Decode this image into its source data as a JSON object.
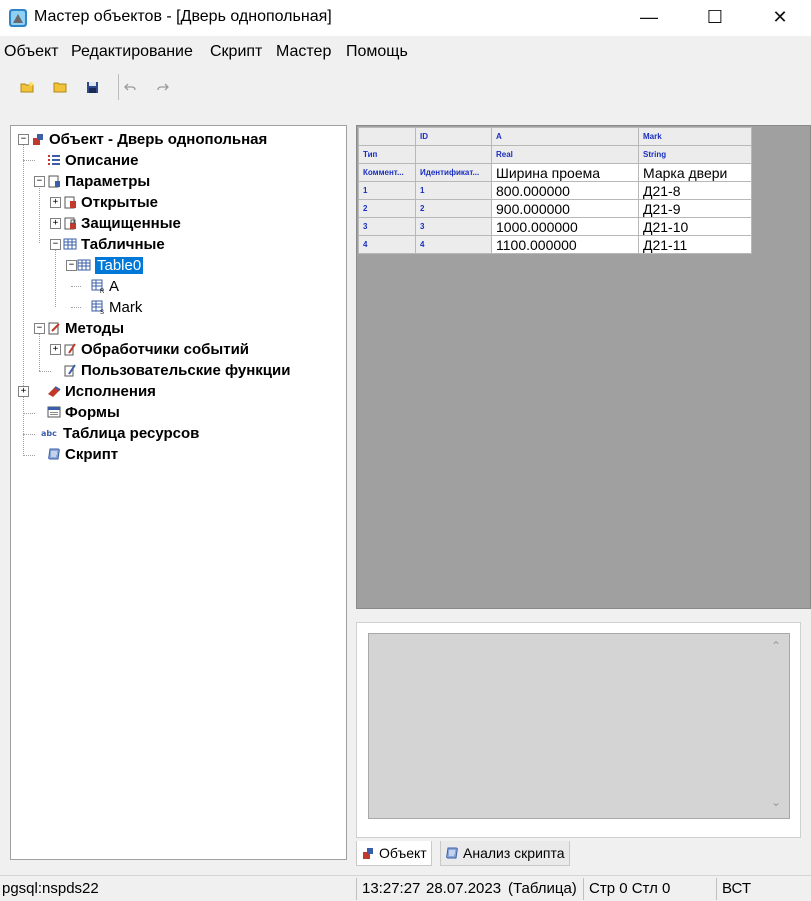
{
  "window": {
    "title": "Мастер объектов - [Дверь однопольная]",
    "controls": {
      "minimize": "—",
      "maximize": "☐",
      "close": "✕"
    }
  },
  "menu": [
    "Объект",
    "Редактирование",
    "Скрипт",
    "Мастер",
    "Помощь"
  ],
  "toolbar": {
    "buttons": [
      "new-icon",
      "open-folder-icon",
      "save-icon",
      "undo-icon",
      "redo-icon"
    ]
  },
  "tree": {
    "root": "Объект - Дверь однопольная",
    "description": "Описание",
    "parameters": "Параметры",
    "open": "Открытые",
    "protected": "Защищенные",
    "tabular": "Табличные",
    "table0": "Table0",
    "col_a": "A",
    "col_mark": "Mark",
    "methods": "Методы",
    "event_handlers": "Обработчики событий",
    "user_functions": "Пользовательские функции",
    "executions": "Исполнения",
    "forms": "Формы",
    "resources": "Таблица ресурсов",
    "script": "Скрипт"
  },
  "grid": {
    "header_top": [
      "",
      "ID",
      "A",
      "Mark"
    ],
    "header_type": [
      "Тип",
      "",
      "Real",
      "String"
    ],
    "header_comment": [
      "Коммент...",
      "Идентификат...",
      "Ширина проема",
      "Марка двери"
    ],
    "rows": [
      [
        "1",
        "1",
        "800.000000",
        "Д21-8"
      ],
      [
        "2",
        "2",
        "900.000000",
        "Д21-9"
      ],
      [
        "3",
        "3",
        "1000.000000",
        "Д21-10"
      ],
      [
        "4",
        "4",
        "1100.000000",
        "Д21-11"
      ]
    ]
  },
  "tabs": {
    "object": "Объект",
    "analysis": "Анализ скрипта"
  },
  "status": {
    "connection": "pgsql:nspds22",
    "time": "13:27:27",
    "date": "28.07.2023",
    "mode": "(Таблица)",
    "position": "Стр 0 Стл 0",
    "insert": "ВСТ"
  },
  "colors": {
    "selection": "#0078d7",
    "header_text": "#1b2fc0",
    "grid_background": "#a0a0a0"
  }
}
